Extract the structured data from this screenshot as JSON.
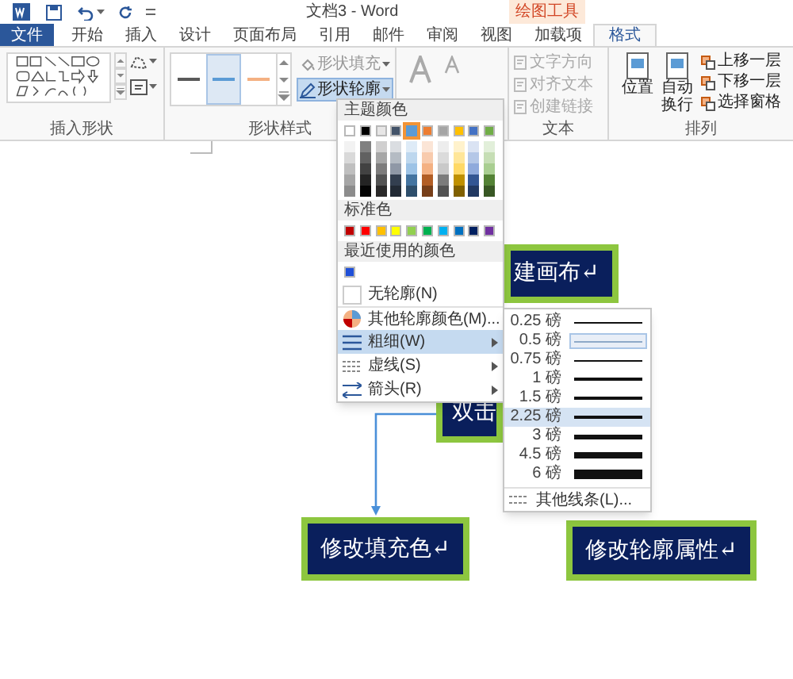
{
  "title_bar": {
    "title": "文档3 - Word",
    "context_tab": "绘图工具"
  },
  "tabs": [
    {
      "label": "文件",
      "kind": "file",
      "selected": false
    },
    {
      "label": "开始",
      "kind": "normal",
      "selected": false
    },
    {
      "label": "插入",
      "kind": "normal",
      "selected": false
    },
    {
      "label": "设计",
      "kind": "normal",
      "selected": false
    },
    {
      "label": "页面布局",
      "kind": "normal",
      "selected": false
    },
    {
      "label": "引用",
      "kind": "normal",
      "selected": false
    },
    {
      "label": "邮件",
      "kind": "normal",
      "selected": false
    },
    {
      "label": "审阅",
      "kind": "normal",
      "selected": false
    },
    {
      "label": "视图",
      "kind": "normal",
      "selected": false
    },
    {
      "label": "加载项",
      "kind": "normal",
      "selected": false
    },
    {
      "label": "格式",
      "kind": "normal",
      "selected": true
    }
  ],
  "ribbon": {
    "insert_shapes": {
      "label": "插入形状"
    },
    "shape_styles": {
      "label": "形状样式",
      "swatches": [
        {
          "color": "#595959",
          "selected": false
        },
        {
          "color": "#5b9bd5",
          "selected": true
        },
        {
          "color": "#f4b183",
          "selected": false
        }
      ],
      "buttons": [
        {
          "label": "形状填充",
          "active": false
        },
        {
          "label": "形状轮廓",
          "active": true
        }
      ]
    },
    "text": {
      "label": "文本",
      "buttons": [
        {
          "label": "文字方向",
          "disabled": true
        },
        {
          "label": "对齐文本",
          "disabled": true
        },
        {
          "label": "创建链接",
          "disabled": true
        }
      ]
    },
    "arrange": {
      "label": "排列",
      "large_buttons": [
        "位置",
        "自动换行"
      ],
      "buttons": [
        "上移一层",
        "下移一层",
        "选择窗格"
      ]
    }
  },
  "outline_menu": {
    "theme_header": "主题颜色",
    "theme_colors": [
      {
        "color": "#ffffff",
        "selected": false
      },
      {
        "color": "#000000",
        "selected": false
      },
      {
        "color": "#e7e6e6",
        "selected": false
      },
      {
        "color": "#44546a",
        "selected": false
      },
      {
        "color": "#5b9bd5",
        "selected": true
      },
      {
        "color": "#ed7d31",
        "selected": false
      },
      {
        "color": "#a5a5a5",
        "selected": false
      },
      {
        "color": "#ffc000",
        "selected": false
      },
      {
        "color": "#4472c4",
        "selected": false
      },
      {
        "color": "#70ad47",
        "selected": false
      }
    ],
    "standard_header": "标准色",
    "standard_colors": [
      {
        "color": "#c00000"
      },
      {
        "color": "#ff0000"
      },
      {
        "color": "#ffc000"
      },
      {
        "color": "#ffff00"
      },
      {
        "color": "#92d050"
      },
      {
        "color": "#00b050"
      },
      {
        "color": "#00b0f0"
      },
      {
        "color": "#0070c0"
      },
      {
        "color": "#002060"
      },
      {
        "color": "#7030a0"
      }
    ],
    "recent_header": "最近使用的颜色",
    "recent_colors": [
      {
        "color": "#1f4fd8"
      }
    ],
    "items": [
      {
        "label": "无轮廓(N)",
        "kind": "none",
        "selected": false
      },
      {
        "label": "其他轮廓颜色(M)...",
        "kind": "palette",
        "selected": false
      },
      {
        "label": "粗细(W)",
        "kind": "weight",
        "selected": true
      },
      {
        "label": "虚线(S)",
        "kind": "dash",
        "selected": false
      },
      {
        "label": "箭头(R)",
        "kind": "arrow",
        "selected": false
      }
    ]
  },
  "weight_menu": {
    "items": [
      {
        "label": "0.25 磅",
        "checked": false,
        "selected": false
      },
      {
        "label": "0.5 磅",
        "checked": true,
        "selected": false
      },
      {
        "label": "0.75 磅",
        "checked": false,
        "selected": false
      },
      {
        "label": "1 磅",
        "checked": false,
        "selected": false
      },
      {
        "label": "1.5 磅",
        "checked": false,
        "selected": false
      },
      {
        "label": "2.25 磅",
        "checked": false,
        "selected": true
      },
      {
        "label": "3 磅",
        "checked": false,
        "selected": false
      },
      {
        "label": "4.5 磅",
        "checked": false,
        "selected": false
      },
      {
        "label": "6 磅",
        "checked": false,
        "selected": false
      }
    ],
    "more": "其他线条(L)..."
  },
  "canvas": {
    "boxes": [
      {
        "text": "建画布↵",
        "kind": "top"
      },
      {
        "text": "双击",
        "kind": "middle"
      },
      {
        "text": "修改填充色↵",
        "kind": "left"
      },
      {
        "text": "修改轮廓属性↵",
        "kind": "right"
      }
    ]
  }
}
